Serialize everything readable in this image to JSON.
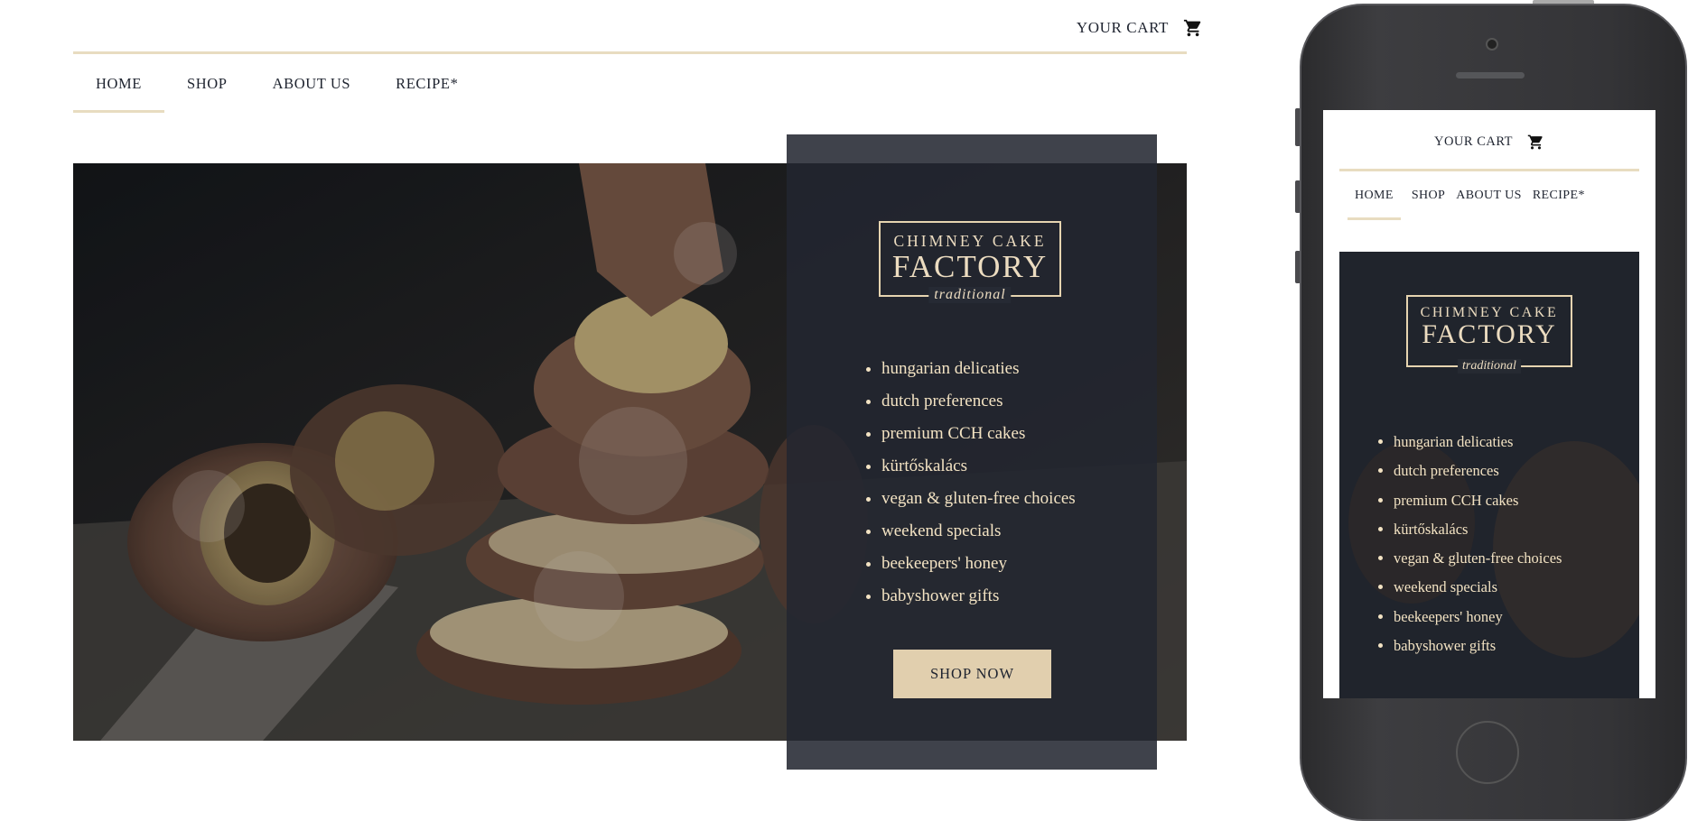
{
  "header": {
    "cart_label": "YOUR CART",
    "cart_icon": "cart-icon"
  },
  "nav": {
    "items": [
      {
        "label": "HOME",
        "active": true
      },
      {
        "label": "SHOP",
        "active": false
      },
      {
        "label": "ABOUT US",
        "active": false
      },
      {
        "label": "RECIPE*",
        "active": false
      }
    ]
  },
  "hero": {
    "logo": {
      "line1": "CHIMNEY CAKE",
      "line2": "FACTORY",
      "tagline": "traditional"
    },
    "features": [
      "hungarian delicaties",
      "dutch preferences",
      "premium CCH cakes",
      "kürtőskalács",
      "vegan & gluten-free choices",
      "weekend specials",
      "beekeepers' honey",
      "babyshower gifts"
    ],
    "cta_label": "SHOP NOW"
  },
  "colors": {
    "accent": "#e1cfae",
    "rule": "#e8dcc0",
    "panel": "#222630",
    "text_dark": "#1f2430",
    "text_light": "#f3e3c3"
  }
}
